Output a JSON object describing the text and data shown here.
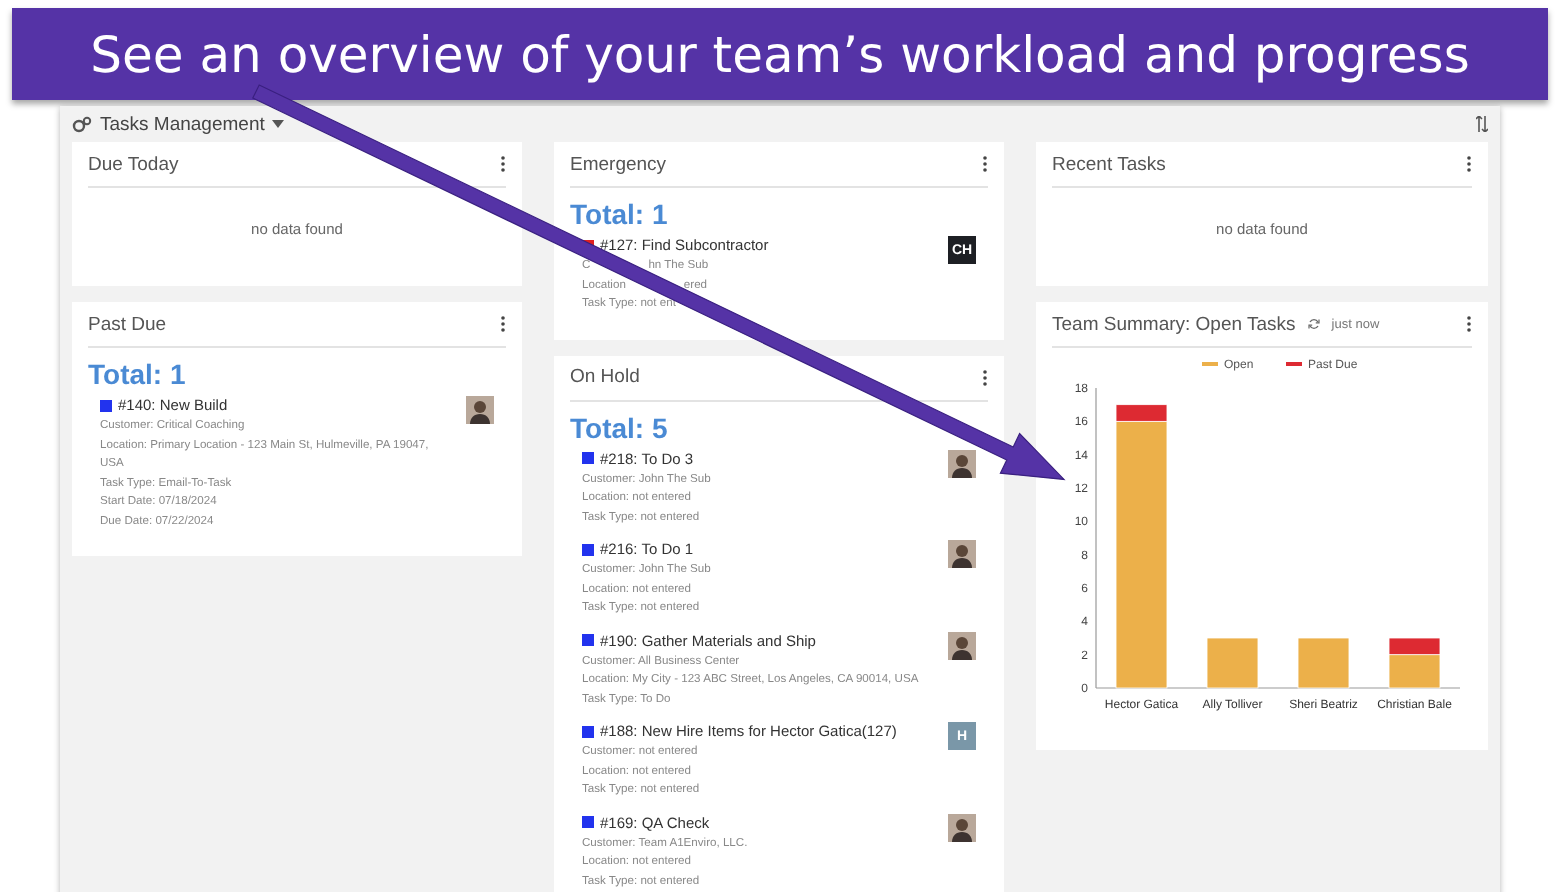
{
  "banner": {
    "title": "See an overview of your team’s workload and progress"
  },
  "header": {
    "title": "Tasks Management"
  },
  "columns": [
    [
      {
        "title": "Due Today",
        "empty": "no data found"
      },
      {
        "title": "Past Due",
        "total": "Total: 1",
        "tasks": [
          {
            "title": "#140: New Build",
            "color": "#2233ee",
            "lines": [
              "Customer: Critical Coaching",
              "Location: Primary Location - 123 Main St, Hulmeville, PA 19047, USA",
              "Task Type: Email-To-Task",
              "Start Date: 07/18/2024",
              "Due Date: 07/22/2024"
            ],
            "avatar": {
              "kind": "photo"
            }
          }
        ]
      }
    ],
    [
      {
        "title": "Emergency",
        "total": "Total: 1",
        "tasks": [
          {
            "title": "#127: Find Subcontractor",
            "color": "#e02020",
            "lines": [
              [
                "C",
                "hn The Sub"
              ],
              [
                "Location",
                "ered"
              ],
              [
                "Task Type: not ent"
              ]
            ],
            "avatar": {
              "kind": "initials",
              "text": "CH"
            }
          }
        ]
      },
      {
        "title": "On Hold",
        "total": "Total: 5",
        "tasks": [
          {
            "title": "#218: To Do 3",
            "color": "#2233ee",
            "lines": [
              "Customer: John The Sub",
              "Location: not entered",
              "Task Type: not entered"
            ],
            "avatar": {
              "kind": "photo"
            }
          },
          {
            "title": "#216: To Do 1",
            "color": "#2233ee",
            "lines": [
              "Customer: John The Sub",
              "Location: not entered",
              "Task Type: not entered"
            ],
            "avatar": {
              "kind": "photo"
            }
          },
          {
            "title": "#190: Gather Materials and Ship",
            "color": "#2233ee",
            "lines": [
              "Customer: All Business Center",
              "Location: My City - 123 ABC Street, Los Angeles, CA 90014, USA",
              "Task Type: To Do"
            ],
            "avatar": {
              "kind": "photo"
            }
          },
          {
            "title": "#188: New Hire Items for Hector Gatica(127)",
            "color": "#2233ee",
            "lines": [
              "Customer: not entered",
              "Location: not entered",
              "Task Type: not entered"
            ],
            "avatar": {
              "kind": "letter",
              "text": "H"
            }
          },
          {
            "title": "#169: QA Check",
            "color": "#2233ee",
            "lines": [
              "Customer: Team A1Enviro, LLC.",
              "Location: not entered",
              "Task Type: not entered"
            ],
            "avatar": {
              "kind": "photo"
            }
          }
        ]
      }
    ],
    [
      {
        "title": "Recent Tasks",
        "empty": "no data found"
      },
      {
        "title": "Team Summary: Open Tasks",
        "status": "just now",
        "chart_data": {
          "type": "bar",
          "stacked": true,
          "categories": [
            "Hector Gatica",
            "Ally Tolliver",
            "Sheri Beatriz",
            "Christian Bale"
          ],
          "series": [
            {
              "name": "Open",
              "color": "#ecb04a",
              "values": [
                16,
                3,
                3,
                2
              ]
            },
            {
              "name": "Past Due",
              "color": "#dd2a32",
              "values": [
                1,
                0,
                0,
                1
              ]
            }
          ],
          "legend": true,
          "ylim": [
            0,
            18
          ],
          "yticks": [
            0,
            2,
            4,
            6,
            8,
            10,
            12,
            14,
            16,
            18
          ]
        }
      }
    ]
  ]
}
